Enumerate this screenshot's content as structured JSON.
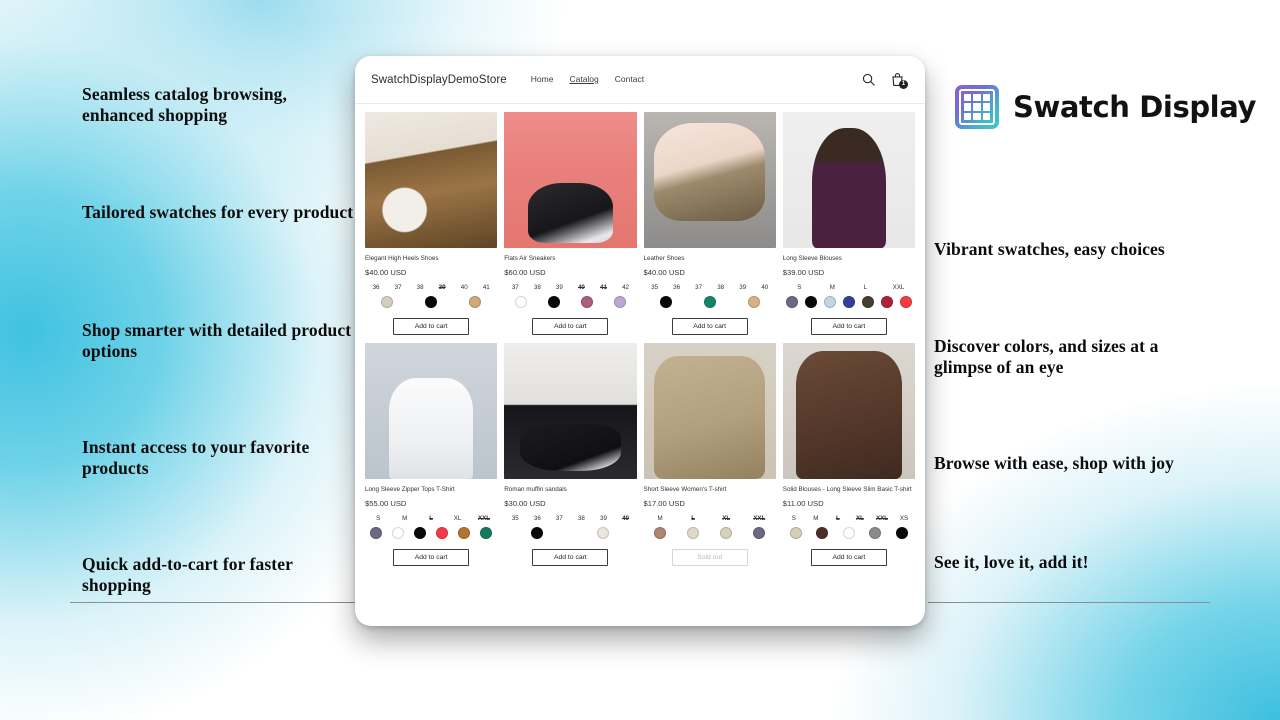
{
  "brand": {
    "name": "Swatch Display",
    "mark_icon": "swatch-grid-icon",
    "gradient_start": "#8b5fd0",
    "gradient_end": "#3fc8c0"
  },
  "promo_left": [
    "Seamless catalog browsing, enhanced shopping",
    "Tailored swatches for every product",
    "Shop smarter with detailed product options",
    "Instant access to your favorite products",
    "Quick add-to-cart for faster shopping"
  ],
  "promo_right": [
    "Vibrant swatches, easy choices",
    "Discover colors, and sizes at a glimpse of an eye",
    "Browse with ease, shop with joy",
    "See it, love it, add it!"
  ],
  "storefront": {
    "logo": "SwatchDisplayDemoStore",
    "nav": [
      {
        "label": "Home",
        "active": false
      },
      {
        "label": "Catalog",
        "active": true
      },
      {
        "label": "Contact",
        "active": false
      }
    ],
    "actions": {
      "search_icon": "search-icon",
      "cart_icon": "shopping-bag-icon",
      "cart_count": "1"
    },
    "add_to_cart_label": "Add to cart",
    "sold_out_label": "Sold out",
    "products": [
      {
        "title": "Elegant High Heels Shoes",
        "price": "$40.00 USD",
        "photo": "ph-1",
        "sizes": [
          {
            "label": "36",
            "available": true
          },
          {
            "label": "37",
            "available": true
          },
          {
            "label": "38",
            "available": true
          },
          {
            "label": "39",
            "available": false
          },
          {
            "label": "40",
            "available": true
          },
          {
            "label": "41",
            "available": true
          }
        ],
        "colors": [
          "#d3cfbc",
          "#090909",
          "#d3a878"
        ],
        "sold_out": false
      },
      {
        "title": "Flats Air Sneakers",
        "price": "$60.00 USD",
        "photo": "ph-2",
        "sizes": [
          {
            "label": "37",
            "available": true
          },
          {
            "label": "38",
            "available": true
          },
          {
            "label": "39",
            "available": true
          },
          {
            "label": "40",
            "available": false
          },
          {
            "label": "41",
            "available": false
          },
          {
            "label": "42",
            "available": true
          }
        ],
        "colors": [
          "#ffffff",
          "#090909",
          "#a95f7e",
          "#bda8d4"
        ],
        "sold_out": false
      },
      {
        "title": "Leather Shoes",
        "price": "$40.00 USD",
        "photo": "ph-3",
        "sizes": [
          {
            "label": "35",
            "available": true
          },
          {
            "label": "36",
            "available": true
          },
          {
            "label": "37",
            "available": true
          },
          {
            "label": "38",
            "available": true
          },
          {
            "label": "39",
            "available": true
          },
          {
            "label": "40",
            "available": true
          }
        ],
        "colors": [
          "#090909",
          "#15836c",
          "#d7b184"
        ],
        "sold_out": false
      },
      {
        "title": "Long Sleeve Blouses",
        "price": "$39.00 USD",
        "photo": "ph-4",
        "sizes": [
          {
            "label": "S",
            "available": true
          },
          {
            "label": "M",
            "available": true
          },
          {
            "label": "L",
            "available": true
          },
          {
            "label": "XXL",
            "available": true
          }
        ],
        "colors": [
          "#6f6880",
          "#090909",
          "#c3d5e4",
          "#33419d",
          "#463f2f",
          "#b02036",
          "#f43a42"
        ],
        "sold_out": false
      },
      {
        "title": "Long Sleeve Zipper Tops T-Shirt",
        "price": "$55.00 USD",
        "photo": "ph-5",
        "sizes": [
          {
            "label": "S",
            "available": true
          },
          {
            "label": "M",
            "available": true
          },
          {
            "label": "L",
            "available": false
          },
          {
            "label": "XL",
            "available": true
          },
          {
            "label": "XXL",
            "available": false
          }
        ],
        "colors": [
          "#6f6880",
          "#ffffff",
          "#090909",
          "#f43a4a",
          "#b2742f",
          "#16785f"
        ],
        "sold_out": false
      },
      {
        "title": "Roman muffin sandals",
        "price": "$30.00 USD",
        "photo": "ph-6",
        "sizes": [
          {
            "label": "35",
            "available": true
          },
          {
            "label": "36",
            "available": true
          },
          {
            "label": "37",
            "available": true
          },
          {
            "label": "38",
            "available": true
          },
          {
            "label": "39",
            "available": true
          },
          {
            "label": "40",
            "available": false
          }
        ],
        "colors": [
          "#090909",
          "#ece6e0"
        ],
        "sold_out": false
      },
      {
        "title": "Short Sleeve Women's T-shirt",
        "price": "$17.00 USD",
        "photo": "ph-7",
        "sizes": [
          {
            "label": "M",
            "available": true
          },
          {
            "label": "L",
            "available": false
          },
          {
            "label": "XL",
            "available": false
          },
          {
            "label": "XXL",
            "available": false
          }
        ],
        "colors": [
          "#ac8573",
          "#e2d8c8",
          "#d7d2bd",
          "#6f6880"
        ],
        "sold_out": true
      },
      {
        "title": "Solid Blouses - Long Sleeve Slim Basic T-shirt",
        "price": "$11.00 USD",
        "photo": "ph-8",
        "sizes": [
          {
            "label": "S",
            "available": true
          },
          {
            "label": "M",
            "available": true
          },
          {
            "label": "L",
            "available": false
          },
          {
            "label": "XL",
            "available": false
          },
          {
            "label": "XXL",
            "available": false
          },
          {
            "label": "XS",
            "available": true
          }
        ],
        "colors": [
          "#d4cfb8",
          "#4c2e26",
          "#ffffff",
          "#8b8b8b",
          "#090909"
        ],
        "sold_out": false
      }
    ]
  }
}
